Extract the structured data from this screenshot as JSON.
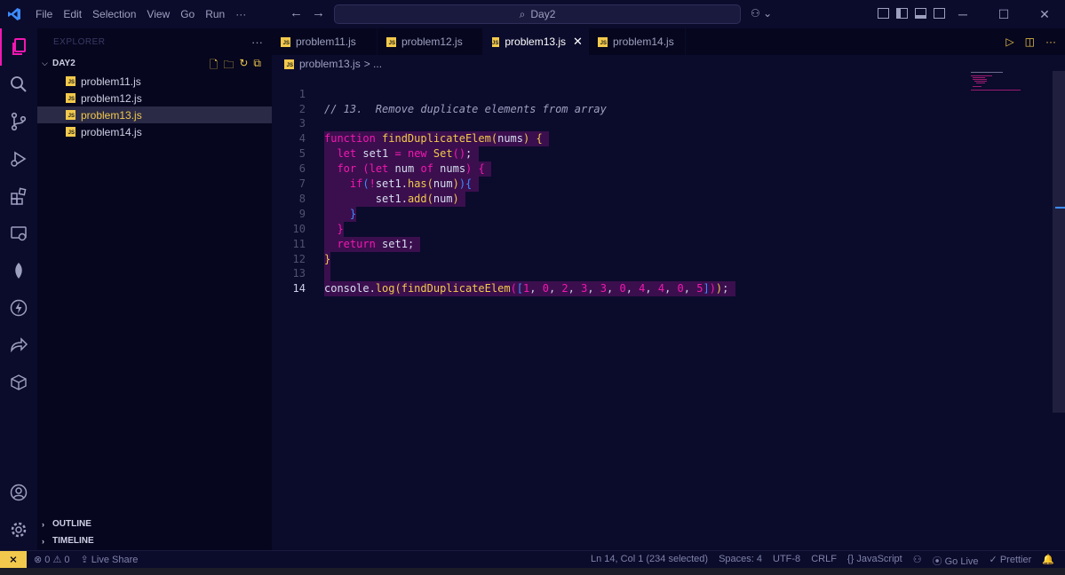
{
  "menu": [
    "File",
    "Edit",
    "Selection",
    "View",
    "Go",
    "Run",
    "···"
  ],
  "search": {
    "text": "Day2"
  },
  "sidebar": {
    "title": "EXPLORER",
    "folder": "DAY2",
    "files": [
      "problem11.js",
      "problem12.js",
      "problem13.js",
      "problem14.js"
    ],
    "selected_index": 2,
    "outline_label": "OUTLINE",
    "timeline_label": "TIMELINE"
  },
  "tabs": [
    "problem11.js",
    "problem12.js",
    "problem13.js",
    "problem14.js"
  ],
  "active_tab": "problem13.js",
  "breadcrumb": {
    "file": "problem13.js",
    "rest": "> ..."
  },
  "editor": {
    "line_numbers": [
      "1",
      "2",
      "3",
      "4",
      "5",
      "6",
      "7",
      "8",
      "9",
      "10",
      "11",
      "12",
      "13",
      "14"
    ],
    "current_line": "14"
  },
  "status": {
    "problems": "0",
    "warnings": "0",
    "live_share": "Live Share",
    "position": "Ln 14, Col 1 (234 selected)",
    "spaces": "Spaces: 4",
    "encoding": "UTF-8",
    "eol": "CRLF",
    "language": "JavaScript",
    "go_live": "Go Live",
    "prettier": "Prettier"
  },
  "colors": {
    "background": "#0b0b2c",
    "accent_pink": "#f218b0",
    "accent_yellow": "#f2c94c",
    "selection": "#3b0f4e"
  }
}
